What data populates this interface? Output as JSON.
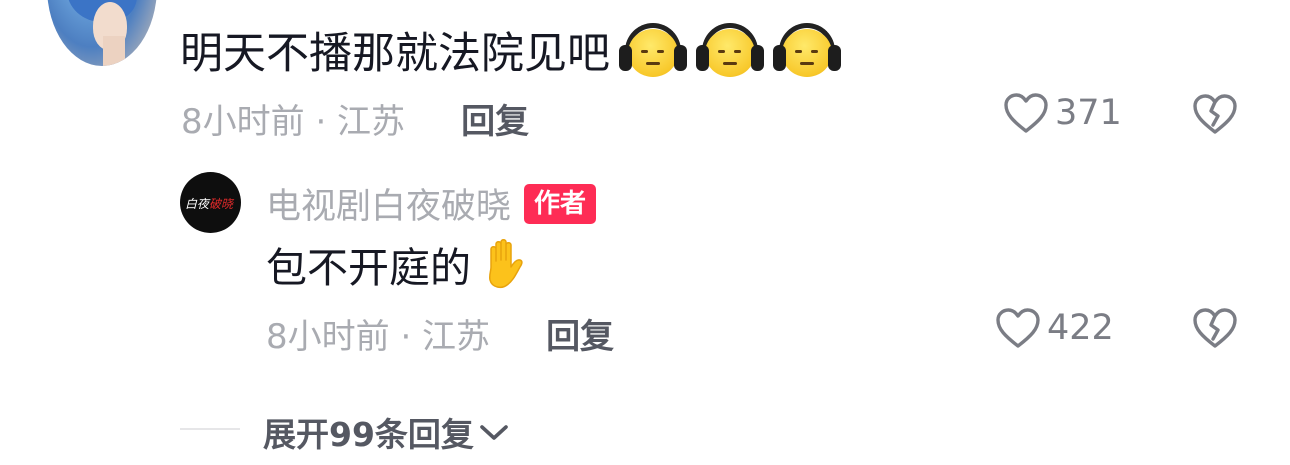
{
  "comment": {
    "avatar": "user-avatar-anime-boy",
    "text": "明天不播那就法院见吧",
    "emojis": [
      "headphone-face-emoji",
      "headphone-face-emoji",
      "headphone-face-emoji"
    ],
    "time_location": "8小时前 · 江苏",
    "reply_label": "回复",
    "like_count": "371",
    "like_icon": "heart-outline-icon",
    "dislike_icon": "broken-heart-icon"
  },
  "author_reply": {
    "avatar": "show-logo-avatar",
    "author_name": "电视剧白夜破晓",
    "badge": "作者",
    "text": "包不开庭的",
    "emoji": "raised-hand-emoji",
    "time_location": "8小时前 · 江苏",
    "reply_label": "回复",
    "like_count": "422",
    "like_icon": "heart-outline-icon",
    "dislike_icon": "broken-heart-icon"
  },
  "expand": {
    "label": "展开99条回复",
    "icon": "chevron-down-icon"
  },
  "colors": {
    "primary_text": "#161823",
    "secondary_text": "#a9abb1",
    "reply_text": "#555862",
    "badge_bg": "#fe2c55",
    "icon_gray": "#7b7d85"
  }
}
